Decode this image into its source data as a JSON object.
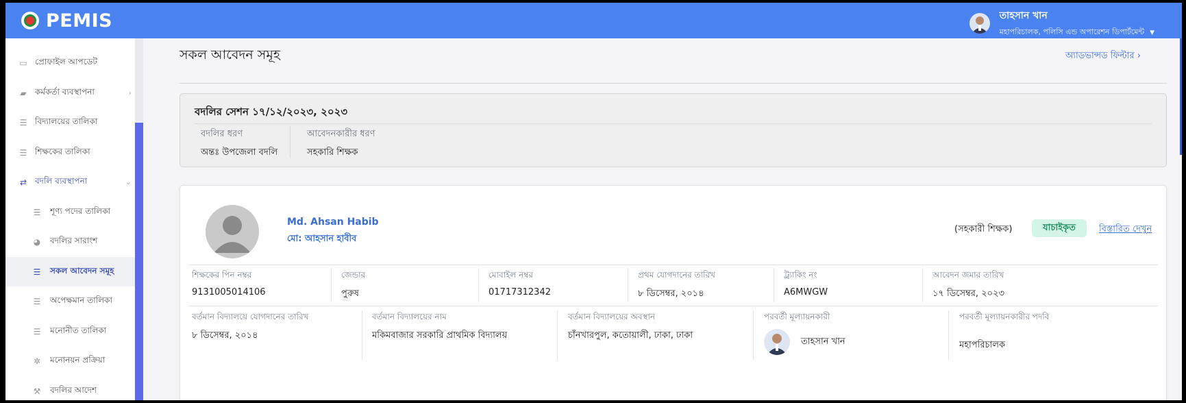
{
  "header": {
    "app_name": "PEMIS",
    "user_name": "তাহসান খান",
    "user_role": "মহাপরিচালক, পলিসি এন্ড অপারেশন ডিপার্টমেন্ট"
  },
  "sidebar": {
    "items": [
      {
        "label": "প্রোফাইল আপডেট",
        "icon": "profile-icon"
      },
      {
        "label": "কর্মকর্তা ব্যবস্থাপনা",
        "icon": "briefcase-icon"
      },
      {
        "label": "বিদ্যালয়ের তালিকা",
        "icon": "list-icon"
      },
      {
        "label": "শিক্ষকের তালিকা",
        "icon": "list-icon"
      },
      {
        "label": "বদলি ব্যবস্থাপনা",
        "icon": "transfer-icon"
      },
      {
        "label": "শূণ্য পদের তালিকা",
        "icon": "list-icon"
      },
      {
        "label": "বদলির সারাংশ",
        "icon": "pie-chart-icon"
      },
      {
        "label": "সকল আবেদন সমূহ",
        "icon": "list-icon"
      },
      {
        "label": "অপেক্ষমান তালিকা",
        "icon": "list-icon"
      },
      {
        "label": "মনোনীত তালিকা",
        "icon": "list-icon"
      },
      {
        "label": "মনোনয়ন প্রক্রিয়া",
        "icon": "gear-icon"
      },
      {
        "label": "বদলির আদেশ",
        "icon": "wrench-icon"
      }
    ],
    "active_item": "সকল আবেদন সমূহ"
  },
  "main": {
    "page_title": "সকল আবেদন সমূহ",
    "advanced_filter": "অ্যাডভান্সড ফিল্টার ›"
  },
  "session": {
    "title": "বদলির সেশন ১৭/১২/২০২৩, ২০২৩",
    "transfer_type_label": "বদলির ধরণ",
    "transfer_type_value": "অন্তঃ উপজেলা বদলি",
    "applicant_type_label": "আবেদনকারীর ধরণ",
    "applicant_type_value": "সহকারি শিক্ষক"
  },
  "application": {
    "name_en": "Md. Ahsan Habib",
    "name_bn": "মো: আহসান হাবীব",
    "role": "(সহকারী শিক্ষক)",
    "status": "যাচাইকৃত",
    "details_link": "বিস্তারিত দেখুন",
    "row1": [
      {
        "label": "শিক্ষকের পিন নম্বর",
        "value": "9131005014106"
      },
      {
        "label": "জেন্ডার",
        "value": "পুরুষ"
      },
      {
        "label": "মোবাইল নম্বর",
        "value": "01717312342"
      },
      {
        "label": "প্রথম যোগদানের তারিখ",
        "value": "৮ ডিসেম্বর, ২০১৪"
      },
      {
        "label": "ট্র্যাকিং নং",
        "value": "A6MWGW"
      },
      {
        "label": "আবেদন জমার তারিখ",
        "value": "১৭ ডিসেম্বর, ২০২৩"
      }
    ],
    "row2": [
      {
        "label": "বর্তমান বিদ্যালয়ে যোগদানের তারিখ",
        "value": "৮ ডিসেম্বর, ২০১৪"
      },
      {
        "label": "বর্তমান বিদ্যালয়ের নাম",
        "value": "মকিমবাজার সরকারি প্রাথমিক বিদ্যালয়"
      },
      {
        "label": "বর্তমান বিদ্যালয়ের অবস্থান",
        "value": "চাঁনখারপুল, কতোয়ালী, ঢাকা, ঢাকা"
      },
      {
        "label": "পরবর্তী মূল্যায়নকারী",
        "value": "তাহসান খান"
      },
      {
        "label": "পরবর্তী মূল্যায়নকারীর পদবি",
        "value": "মহাপরিচালক"
      }
    ]
  },
  "colors": {
    "header_bg": "#4a82f0",
    "accent": "#3a6fd8",
    "sidebar_active": "#3f51b5",
    "status_bg": "#d4f4e8",
    "status_text": "#1f8f5e"
  }
}
